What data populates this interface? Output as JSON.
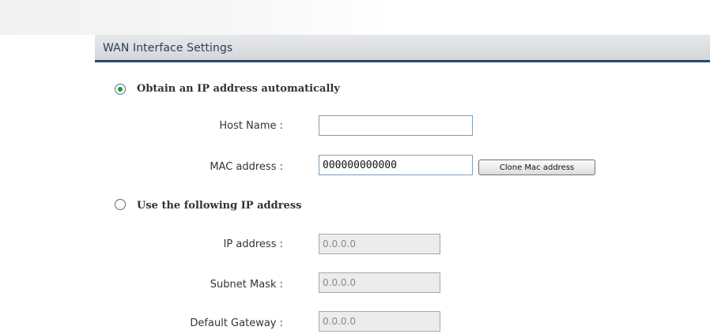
{
  "section": {
    "title": "WAN Interface Settings"
  },
  "options": {
    "auto": {
      "label": "Obtain an IP address automatically",
      "selected": true
    },
    "static": {
      "label": "Use the following IP address",
      "selected": false
    }
  },
  "auto_fields": {
    "host_name": {
      "label": "Host Name :",
      "value": ""
    },
    "mac_address": {
      "label": "MAC address :",
      "value": "000000000000"
    },
    "clone_button": "Clone Mac address"
  },
  "static_fields": {
    "ip_address": {
      "label": "IP address :",
      "value": "0.0.0.0"
    },
    "subnet_mask": {
      "label": "Subnet Mask :",
      "value": "0.0.0.0"
    },
    "default_gateway": {
      "label": "Default Gateway :",
      "value": "0.0.0.0"
    }
  },
  "colors": {
    "header_border": "#2a4a69",
    "radio_dot": "#1d9b2a"
  }
}
